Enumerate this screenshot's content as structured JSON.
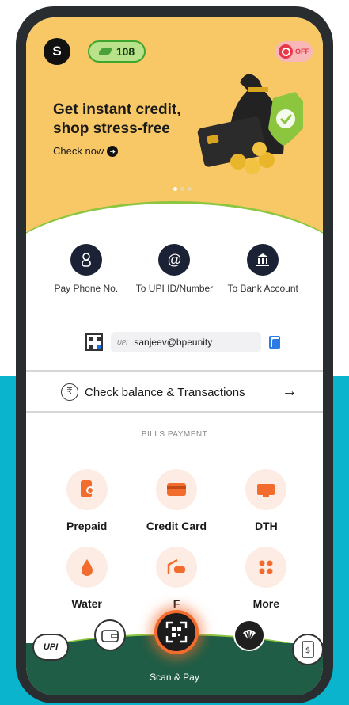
{
  "header": {
    "avatar_initial": "S",
    "points": "108",
    "toggle_label": "OFF"
  },
  "promo": {
    "title": "Get instant credit, shop stress-free",
    "link": "Check now"
  },
  "pay": {
    "items": [
      {
        "label": "Pay Phone No.",
        "icon": "phone-icon"
      },
      {
        "label": "To UPI ID/Number",
        "icon": "at-icon"
      },
      {
        "label": "To Bank Account",
        "icon": "bank-icon"
      }
    ],
    "upi_id": "sanjeev@bpeunity",
    "upi_tag": "UPI"
  },
  "balance": {
    "label": "Check balance & Transactions",
    "rupee": "₹",
    "arrow": "→"
  },
  "bills": {
    "header": "BILLS PAYMENT",
    "items": [
      {
        "label": "Prepaid",
        "icon": "prepaid-mobile-icon"
      },
      {
        "label": "Credit Card",
        "icon": "credit-card-icon"
      },
      {
        "label": "DTH",
        "icon": "dth-icon"
      },
      {
        "label": "Water",
        "icon": "water-drop-icon"
      },
      {
        "label": "F",
        "icon": "fastag-icon"
      },
      {
        "label": "More",
        "icon": "more-grid-icon"
      }
    ]
  },
  "bottom": {
    "scan_label": "Scan & Pay",
    "upi_logo": "UPI"
  },
  "colors": {
    "promo_bg": "#f8c866",
    "accent_orange": "#f26c2d",
    "dark_green": "#1f5d46",
    "teal_bg": "#0ab4cc"
  }
}
